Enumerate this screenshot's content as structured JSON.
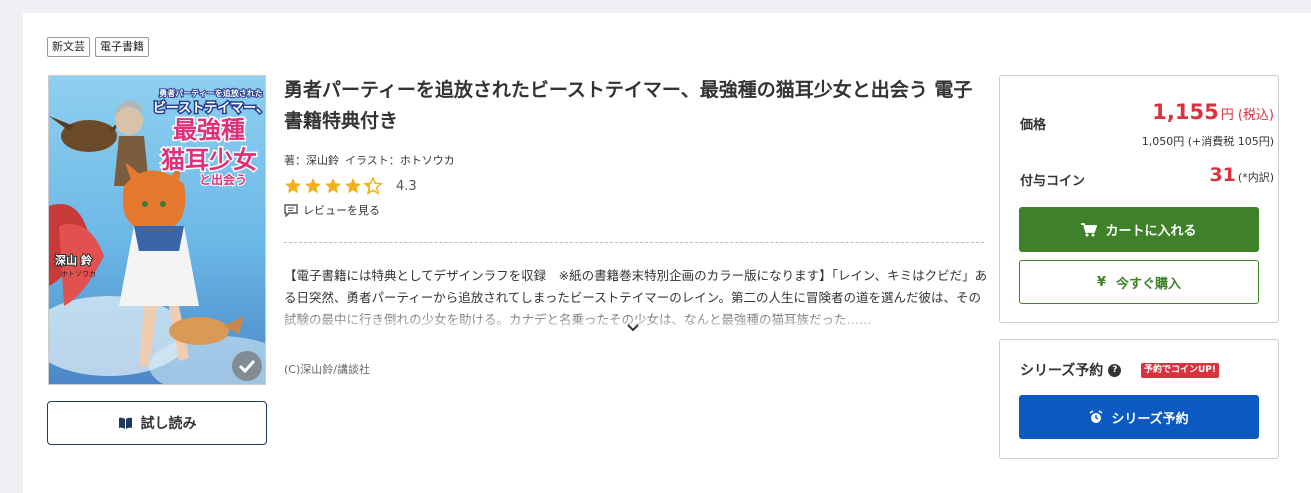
{
  "tags": [
    "新文芸",
    "電子書籍"
  ],
  "book": {
    "title": "勇者パーティーを追放されたビーストテイマー、最強種の猫耳少女と出会う 電子書籍特典付き",
    "author_prefix": "著：",
    "author": "深山鈴",
    "illustrator_prefix": "イラスト：",
    "illustrator": "ホトソウカ",
    "rating": "4.3",
    "rating_stars": 4.3,
    "review_link": "レビューを見る",
    "description": "【電子書籍には特典としてデザインラフを収録　※紙の書籍巻末特別企画のカラー版になります】「レイン、キミはクビだ」ある日突然、勇者パーティーから追放されてしまったビーストテイマーのレイン。第二の人生に冒険者の道を選んだ彼は、その試験の最中に行き倒れの少女を助ける。カナデと名乗ったその少女は、なんと最強種の猫耳族だった……",
    "copyright": "(C)深山鈴/講談社",
    "trial_button": "試し読み"
  },
  "cover": {
    "title_line1": "勇者パーティーを追放された",
    "title_line2": "ビーストテイマー、",
    "title_line3": "最強種",
    "title_line4": "猫耳少女",
    "title_line5": "と出会う",
    "author": "深山 鈴",
    "illustrator": "ホトソウカ"
  },
  "pricing": {
    "price_label": "価格",
    "price": "1,155",
    "price_unit": "円 (税込)",
    "price_sub": "1,050円 (+消費税 105円)",
    "coin_label": "付与コイン",
    "coin": "31",
    "coin_note": "(*内訳)",
    "cart_button": "カートに入れる",
    "buy_button": "今すぐ購入"
  },
  "series": {
    "title": "シリーズ予約",
    "badge": "予約でコインUP!",
    "button": "シリーズ予約"
  },
  "colors": {
    "price_red": "#d9333f",
    "cart_green": "#3f8128",
    "series_blue": "#0a5ac2",
    "star_gold": "#f2b01e"
  }
}
